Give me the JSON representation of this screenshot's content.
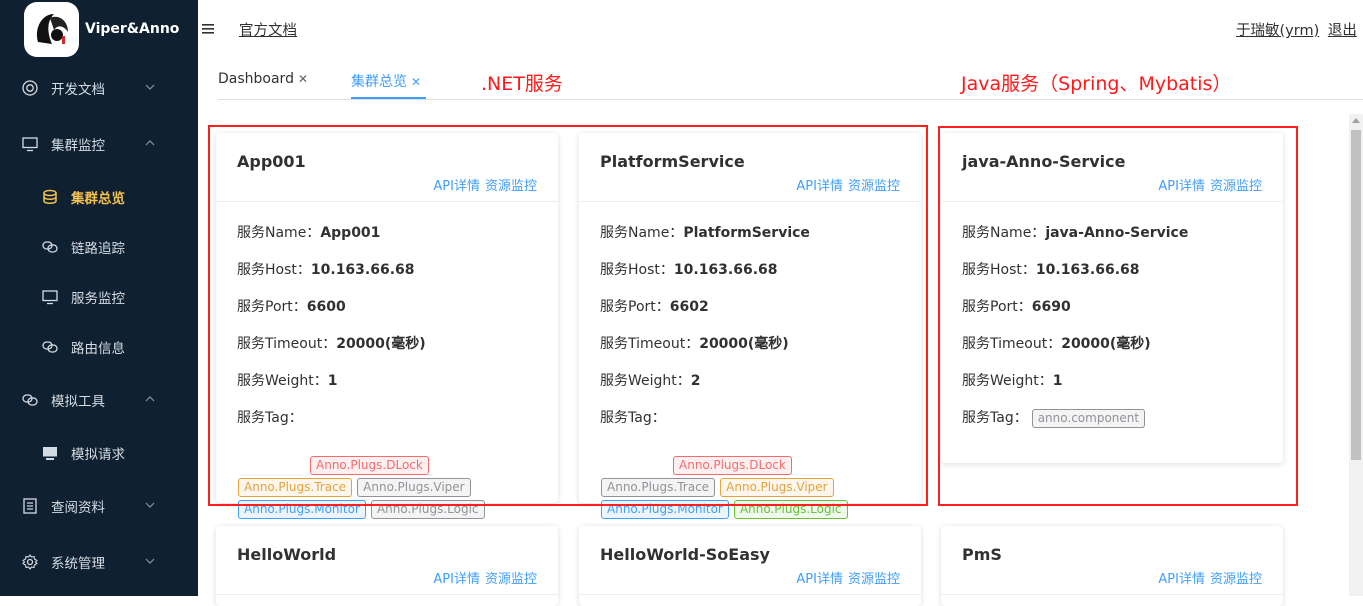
{
  "app": {
    "name": "Viper&Anno"
  },
  "sidebar": {
    "items": [
      {
        "label": "开发文档",
        "icon": "target-icon",
        "expanded": false
      },
      {
        "label": "集群监控",
        "icon": "monitor-icon",
        "expanded": true,
        "children": [
          {
            "label": "集群总览",
            "icon": "cluster-icon",
            "active": true
          },
          {
            "label": "链路追踪",
            "icon": "link-icon"
          },
          {
            "label": "服务监控",
            "icon": "monitor-icon"
          },
          {
            "label": "路由信息",
            "icon": "link-icon"
          }
        ]
      },
      {
        "label": "模拟工具",
        "icon": "link-icon",
        "expanded": true,
        "children": [
          {
            "label": "模拟请求",
            "icon": "monitor-solid-icon"
          }
        ]
      },
      {
        "label": "查阅资料",
        "icon": "document-icon",
        "expanded": false
      },
      {
        "label": "系统管理",
        "icon": "gear-icon",
        "expanded": false
      }
    ]
  },
  "header": {
    "doc_link": "官方文档",
    "user": "于瑞敏(yrm)",
    "logout": "退出"
  },
  "tabs": [
    {
      "label": "Dashboard",
      "active": false
    },
    {
      "label": "集群总览",
      "active": true
    }
  ],
  "annotations": {
    "net": ".NET服务",
    "java": "Java服务（Spring、Mybatis）"
  },
  "card_labels": {
    "api": "API详情",
    "resource": "资源监控",
    "name": "服务Name：",
    "host": "服务Host：",
    "port": "服务Port：",
    "timeout": "服务Timeout：",
    "weight": "服务Weight：",
    "tag": "服务Tag："
  },
  "services": [
    {
      "title": "App001",
      "name": "App001",
      "host": "10.163.66.68",
      "port": "6600",
      "timeout": "20000(毫秒)",
      "weight": "1",
      "tags": [
        {
          "text": "Anno.Plugs.DLock",
          "color": "red"
        },
        {
          "text": "Anno.Plugs.Trace",
          "color": "orange"
        },
        {
          "text": "Anno.Plugs.Viper",
          "color": "gray"
        },
        {
          "text": "Anno.Plugs.Monitor",
          "color": "blue"
        },
        {
          "text": "Anno.Plugs.Logic",
          "color": "gray"
        }
      ]
    },
    {
      "title": "PlatformService",
      "name": "PlatformService",
      "host": "10.163.66.68",
      "port": "6602",
      "timeout": "20000(毫秒)",
      "weight": "2",
      "tags": [
        {
          "text": "Anno.Plugs.DLock",
          "color": "red"
        },
        {
          "text": "Anno.Plugs.Trace",
          "color": "gray"
        },
        {
          "text": "Anno.Plugs.Viper",
          "color": "orange"
        },
        {
          "text": "Anno.Plugs.Monitor",
          "color": "blue"
        },
        {
          "text": "Anno.Plugs.Logic",
          "color": "green"
        }
      ]
    },
    {
      "title": "java-Anno-Service",
      "name": "java-Anno-Service",
      "host": "10.163.66.68",
      "port": "6690",
      "timeout": "20000(毫秒)",
      "weight": "1",
      "tags": [
        {
          "text": "anno.component",
          "color": "gray"
        }
      ]
    },
    {
      "title": "HelloWorld"
    },
    {
      "title": "HelloWorld-SoEasy"
    },
    {
      "title": "PmS"
    }
  ],
  "colors": {
    "sidebar_bg": "#0f2031",
    "active_menu": "#f2c14e",
    "link": "#409eff",
    "annotation": "#ff1a1a"
  }
}
